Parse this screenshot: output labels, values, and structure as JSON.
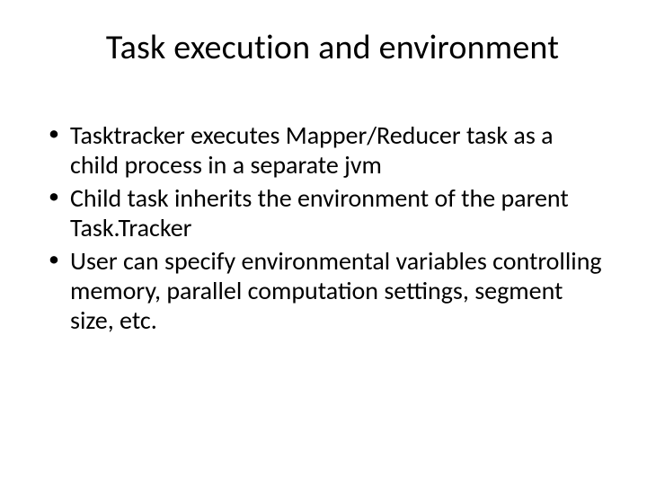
{
  "slide": {
    "title": "Task execution and environment",
    "bullets": [
      "Tasktracker executes Mapper/Reducer task as a child process in a separate jvm",
      "Child task inherits the environment of the parent Task.Tracker",
      "User can specify environmental variables controlling memory, parallel computation settings, segment size, etc."
    ]
  }
}
